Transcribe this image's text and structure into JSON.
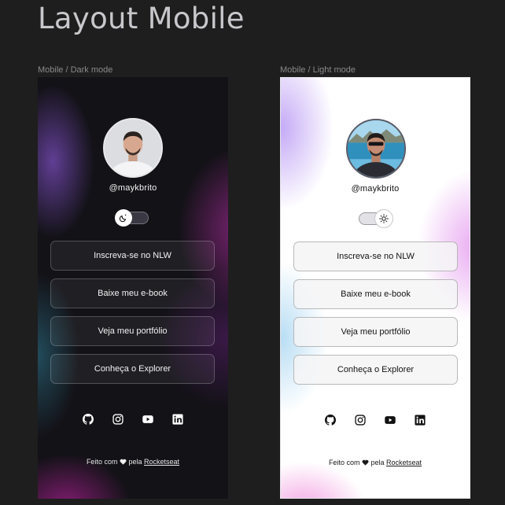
{
  "page": {
    "title": "Layout Mobile"
  },
  "frames": [
    {
      "label": "Mobile / Dark mode",
      "handle": "@maykbrito",
      "mode": "dark",
      "toggle_icon": "moon-icon",
      "buttons": [
        "Inscreva-se no NLW",
        "Baixe meu e-book",
        "Veja meu portfólio",
        "Conheça o Explorer"
      ],
      "socials": [
        "github-icon",
        "instagram-icon",
        "youtube-icon",
        "linkedin-icon"
      ],
      "footer": {
        "made_with": "Feito com",
        "by": "pela",
        "brand": "Rocketseat"
      }
    },
    {
      "label": "Mobile / Light mode",
      "handle": "@maykbrito",
      "mode": "light",
      "toggle_icon": "sun-icon",
      "buttons": [
        "Inscreva-se no NLW",
        "Baixe meu e-book",
        "Veja meu portfólio",
        "Conheça o Explorer"
      ],
      "socials": [
        "github-icon",
        "instagram-icon",
        "youtube-icon",
        "linkedin-icon"
      ],
      "footer": {
        "made_with": "Feito com",
        "by": "pela",
        "brand": "Rocketseat"
      }
    }
  ],
  "colors": {
    "canvas": "#1e1e1e",
    "dark_bg": "#131217",
    "light_bg": "#ffffff",
    "accent_pink": "#e38ce0",
    "accent_purple": "#8a4fc7"
  }
}
